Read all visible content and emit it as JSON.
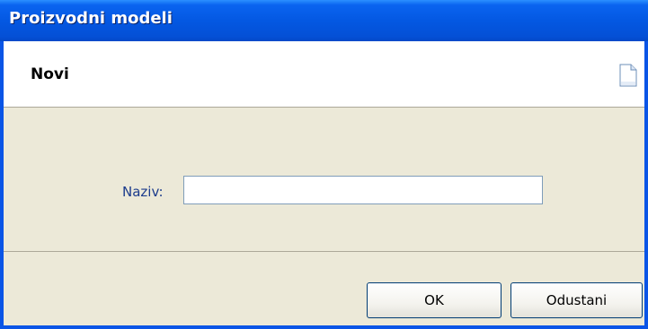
{
  "window": {
    "title": "Proizvodni modeli"
  },
  "header": {
    "title": "Novi",
    "icon": "new-document-icon"
  },
  "form": {
    "name_label": "Naziv:",
    "name_value": "",
    "name_placeholder": ""
  },
  "footer": {
    "ok_label": "OK",
    "cancel_label": "Odustani"
  },
  "colors": {
    "titlebar": "#0458e2",
    "dialog_bg": "#ece9d8",
    "label_text": "#1c3c8c"
  }
}
